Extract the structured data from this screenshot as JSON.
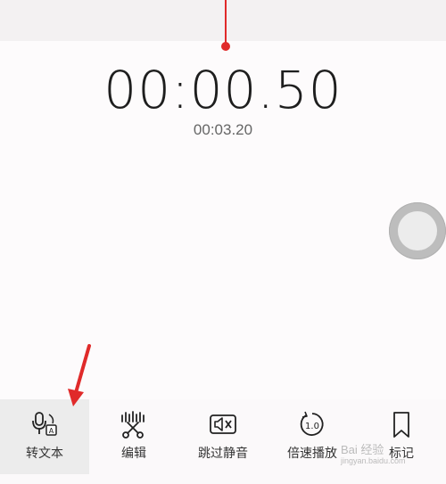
{
  "player": {
    "current_time": "00:00.50",
    "total_time": "00:03.20"
  },
  "toolbar": {
    "items": [
      {
        "label": "转文本",
        "icon": "speech-to-text-icon"
      },
      {
        "label": "编辑",
        "icon": "edit-scissors-icon"
      },
      {
        "label": "跳过静音",
        "icon": "skip-silence-icon"
      },
      {
        "label": "倍速播放",
        "icon": "playback-speed-icon"
      },
      {
        "label": "标记",
        "icon": "bookmark-icon"
      }
    ],
    "speed_badge": "1.0",
    "transcribe_badge": "A"
  },
  "colors": {
    "playhead": "#e02a2a",
    "annotation_arrow": "#e02a2a"
  },
  "watermark": {
    "line1": "Bai 经验",
    "line2": "jingyan.baidu.com"
  }
}
